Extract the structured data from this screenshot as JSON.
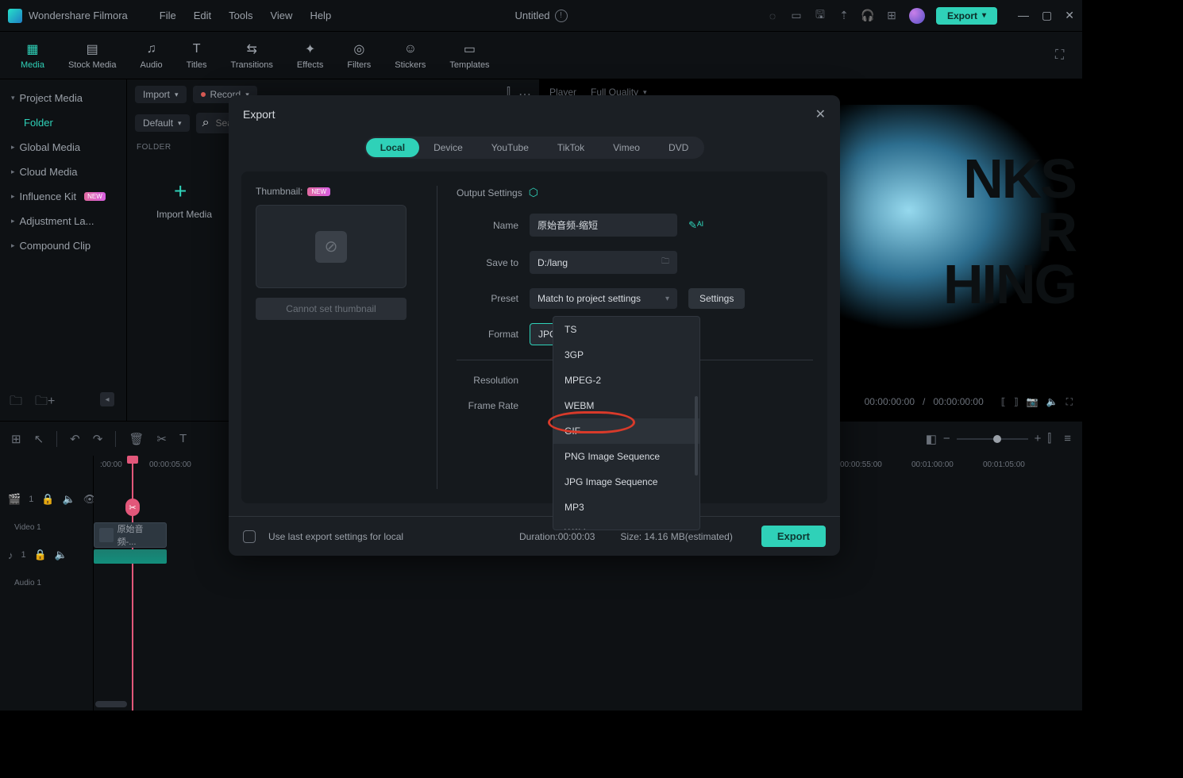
{
  "app": {
    "name": "Wondershare Filmora",
    "doc_title": "Untitled"
  },
  "menus": [
    "File",
    "Edit",
    "Tools",
    "View",
    "Help"
  ],
  "titlebar_export": "Export",
  "tooltabs": [
    {
      "label": "Media",
      "icon": "▦"
    },
    {
      "label": "Stock Media",
      "icon": "▤"
    },
    {
      "label": "Audio",
      "icon": "♫"
    },
    {
      "label": "Titles",
      "icon": "T"
    },
    {
      "label": "Transitions",
      "icon": "⇆"
    },
    {
      "label": "Effects",
      "icon": "✦"
    },
    {
      "label": "Filters",
      "icon": "◎"
    },
    {
      "label": "Stickers",
      "icon": "☺"
    },
    {
      "label": "Templates",
      "icon": "▭"
    }
  ],
  "sidebar": {
    "items": [
      {
        "label": "Project Media",
        "active": false
      },
      {
        "label": "Folder",
        "active": true,
        "indent": true
      },
      {
        "label": "Global Media"
      },
      {
        "label": "Cloud Media"
      },
      {
        "label": "Influence Kit",
        "badge": "NEW"
      },
      {
        "label": "Adjustment La..."
      },
      {
        "label": "Compound Clip"
      }
    ]
  },
  "mid": {
    "import": "Import",
    "record": "Record",
    "default": "Default",
    "search_placeholder": "Sea",
    "folder_label": "FOLDER",
    "import_media": "Import Media"
  },
  "preview": {
    "player": "Player",
    "quality": "Full Quality",
    "bigtext_lines": [
      "NKS",
      "R",
      "HING"
    ],
    "time_a": "00:00:00:00",
    "time_b": "00:00:00:00"
  },
  "timeline": {
    "ticks": [
      ":00:00",
      "00:00:05:00",
      "00:00:55:00",
      "00:01:00:00",
      "00:01:05:00"
    ],
    "tracks": [
      {
        "icon": "🎬",
        "label": "Video 1"
      },
      {
        "icon": "♪",
        "label": "Audio 1"
      }
    ],
    "clip_name": "原始音频-..."
  },
  "export_dialog": {
    "title": "Export",
    "tabs": [
      "Local",
      "Device",
      "YouTube",
      "TikTok",
      "Vimeo",
      "DVD"
    ],
    "active_tab": "Local",
    "thumbnail_label": "Thumbnail:",
    "thumbnail_badge": "NEW",
    "cannot_set": "Cannot set thumbnail",
    "output_settings": "Output Settings",
    "fields": {
      "name_label": "Name",
      "name_value": "原始音频-缩短",
      "saveto_label": "Save to",
      "saveto_value": "D:/lang",
      "preset_label": "Preset",
      "preset_value": "Match to project settings",
      "settings_btn": "Settings",
      "format_label": "Format",
      "format_value": "JPG Image Sequence",
      "resolution_label": "Resolution",
      "framerate_label": "Frame Rate"
    },
    "format_options": [
      "TS",
      "3GP",
      "MPEG-2",
      "WEBM",
      "GIF",
      "PNG Image Sequence",
      "JPG Image Sequence",
      "MP3",
      "WAV"
    ],
    "highlighted_option": "GIF",
    "footer": {
      "checkbox_label": "Use last export settings for local",
      "duration": "Duration:00:00:03",
      "size": "Size: 14.16 MB(estimated)",
      "export_btn": "Export"
    }
  }
}
